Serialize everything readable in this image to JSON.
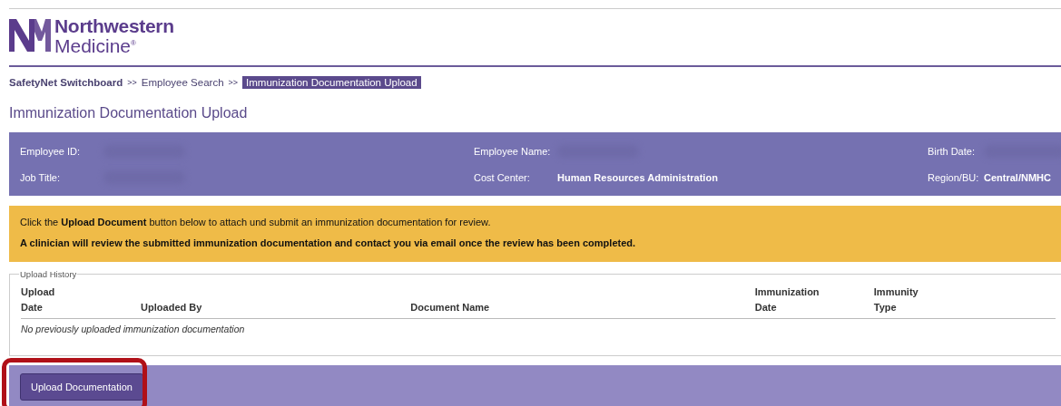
{
  "logo": {
    "line_1": "Northwestern",
    "line_2": "Medicine$^{®}$"
  },
  "breadcrumbs": [
    {
      "label": "SafetyNet Switchboard",
      "kind": "root",
      "selected": false
    },
    {
      "label": ">>",
      "kind": "separator",
      "selected": false
    },
    {
      "label": "Employee Search",
      "kind": "link",
      "selected": false
    },
    {
      "label": ">>",
      "kind": "separator",
      "selected": false
    },
    {
      "label": "Immunization Documentation Upload",
      "kind": "link",
      "selected": true
    }
  ],
  "page_title": "Immunization Documentation Upload",
  "employee_info": [
    {
      "label": "Employee ID:",
      "redacted": true
    },
    {
      "label": "Employee Name:",
      "redacted": true
    },
    {
      "label": "Birth Date:",
      "redacted": true
    },
    {
      "label": "Job Title:",
      "redacted": true
    },
    {
      "label": "Cost Center:",
      "value": "Human Resources Administration",
      "redacted": false
    },
    {
      "label": "Region/BU:",
      "value": "Central/NMHC",
      "redacted": false
    }
  ],
  "notice": {
    "line_1": "Click the **Upload Document** button below to attach und submit an immunization documentation for review.",
    "line_2": "A clinician will review the submitted immunization documentation and contact you via email once the review has been completed."
  },
  "upload_history": {
    "legend": "Upload History",
    "columns": [
      [
        "Upload",
        "Date"
      ],
      [
        "Uploaded By"
      ],
      [
        "Document Name"
      ],
      [
        "Immunization",
        "Date"
      ],
      [
        "Immunity",
        "Type"
      ]
    ],
    "empty_message": "No previously uploaded immunization documentation"
  },
  "upload_button": {
    "label": "Upload Documentation",
    "highlighted": true
  }
}
